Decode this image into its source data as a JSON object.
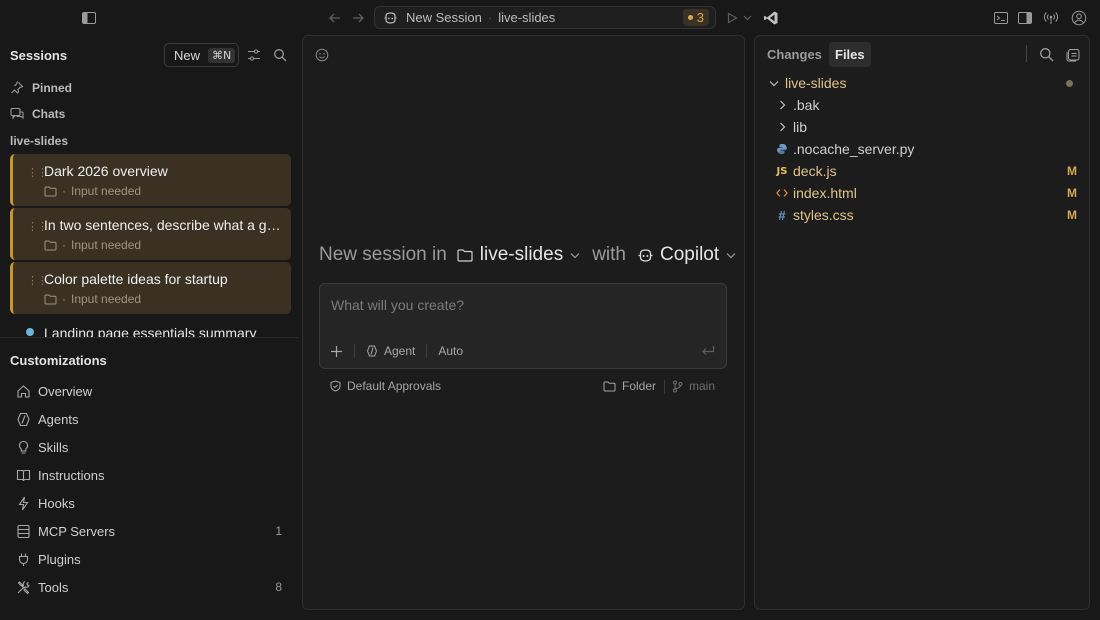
{
  "titlebar": {
    "session_title": "New Session",
    "session_sep": "·",
    "session_folder": "live-slides",
    "badge_count": "3"
  },
  "sidebar": {
    "title": "Sessions",
    "new_label": "New",
    "new_shortcut": "⌘N",
    "nav": [
      {
        "label": "Pinned",
        "icon": "pin-icon"
      },
      {
        "label": "Chats",
        "icon": "chats-icon"
      }
    ],
    "group_label": "live-slides",
    "sessions": [
      {
        "title": "Dark 2026 overview",
        "sep": "·",
        "status": "Input needed"
      },
      {
        "title": "In two sentences, describe what a go...",
        "sep": "·",
        "status": "Input needed"
      },
      {
        "title": "Color palette ideas for startup",
        "sep": "·",
        "status": "Input needed"
      }
    ],
    "partial_session": "Landing page essentials summary",
    "customizations_title": "Customizations",
    "customizations": [
      {
        "label": "Overview",
        "icon": "home-icon",
        "count": ""
      },
      {
        "label": "Agents",
        "icon": "agent-icon",
        "count": ""
      },
      {
        "label": "Skills",
        "icon": "lightbulb-icon",
        "count": ""
      },
      {
        "label": "Instructions",
        "icon": "book-icon",
        "count": ""
      },
      {
        "label": "Hooks",
        "icon": "lightning-icon",
        "count": ""
      },
      {
        "label": "MCP Servers",
        "icon": "server-icon",
        "count": "1"
      },
      {
        "label": "Plugins",
        "icon": "plug-icon",
        "count": ""
      },
      {
        "label": "Tools",
        "icon": "tools-icon",
        "count": "8"
      }
    ]
  },
  "center": {
    "new_session_in": "New session in",
    "folder": "live-slides",
    "with": "with",
    "model": "Copilot",
    "placeholder": "What will you create?",
    "mode": "Agent",
    "auto": "Auto",
    "approvals": "Default Approvals",
    "folder_label": "Folder",
    "branch": "main"
  },
  "files_panel": {
    "tabs": [
      {
        "label": "Changes",
        "active": false
      },
      {
        "label": "Files",
        "active": true
      }
    ],
    "tree": [
      {
        "name": "live-slides",
        "kind": "root",
        "status": "",
        "color": "#e0c48a"
      },
      {
        "name": ".bak",
        "kind": "folder",
        "status": "",
        "color": "#cfcfcf"
      },
      {
        "name": "lib",
        "kind": "folder",
        "status": "",
        "color": "#cfcfcf"
      },
      {
        "name": ".nocache_server.py",
        "kind": "python",
        "status": "",
        "color": "#cfcfcf"
      },
      {
        "name": "deck.js",
        "kind": "js",
        "status": "M",
        "color": "#e0c48a"
      },
      {
        "name": "index.html",
        "kind": "html",
        "status": "M",
        "color": "#e0c48a"
      },
      {
        "name": "styles.css",
        "kind": "css",
        "status": "M",
        "color": "#e0c48a"
      }
    ]
  },
  "colors": {
    "accent": "#c9952f",
    "modified": "#d7a855",
    "card_bg": "#3a3122"
  }
}
